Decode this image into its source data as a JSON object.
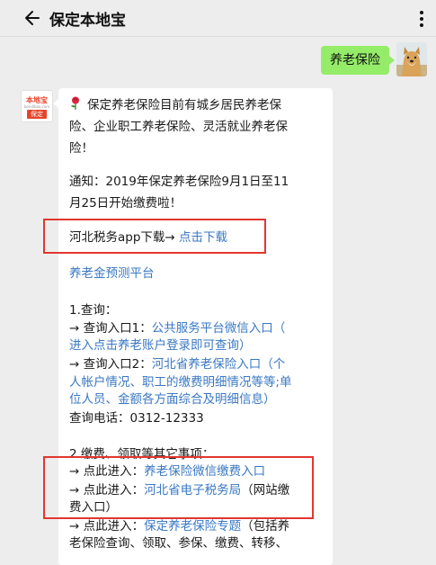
{
  "header": {
    "title": "保定本地宝"
  },
  "user_message": {
    "text": "养老保险"
  },
  "bot_avatar": {
    "line1": "本地宝",
    "line2": "bendibao.com",
    "line3": "保定"
  },
  "reply": {
    "intro": [
      "保定养老保险目前有城乡居民养老保",
      "险、企业职工养老保险、灵活就业养老保",
      "险！"
    ],
    "notice": [
      "通知：2019年保定养老保险9月1日至11",
      "月25日开始缴费啦！"
    ],
    "tax_app": {
      "prefix": "河北税务app下载→ ",
      "link": "点击下载"
    },
    "pension_calc": "养老金预测平台",
    "query": {
      "heading": " 1.查询：",
      "entry1_prefix": "→ 查询入口1：",
      "entry1_link": [
        "公共服务平台微信入口（",
        "进入点击养老账户登录即可查询）"
      ],
      "entry2_prefix": "→ 查询入口2：",
      "entry2_link": [
        "河北省养老保险入口（个",
        "人帐户情况、职工的缴费明细情况等等;单",
        "位人员、金额各方面综合及明细信息）"
      ],
      "phone": "查询电话：0312-12333"
    },
    "payment": {
      "heading": " 2.缴费、领取等其它事项：",
      "item1_prefix": "→ 点此进入：",
      "item1_link": "养老保险微信缴费入口",
      "item2_prefix": "→ 点此进入：",
      "item2_link": "河北省电子税务局",
      "item2_suffix": [
        "（网站缴",
        "费入口）"
      ],
      "item3_prefix": "→ 点此进入：",
      "item3_link": "保定养老保险专题",
      "item3_suffix": [
        "（包括养",
        "老保险查询、领取、参保、缴费、转移、"
      ]
    }
  }
}
